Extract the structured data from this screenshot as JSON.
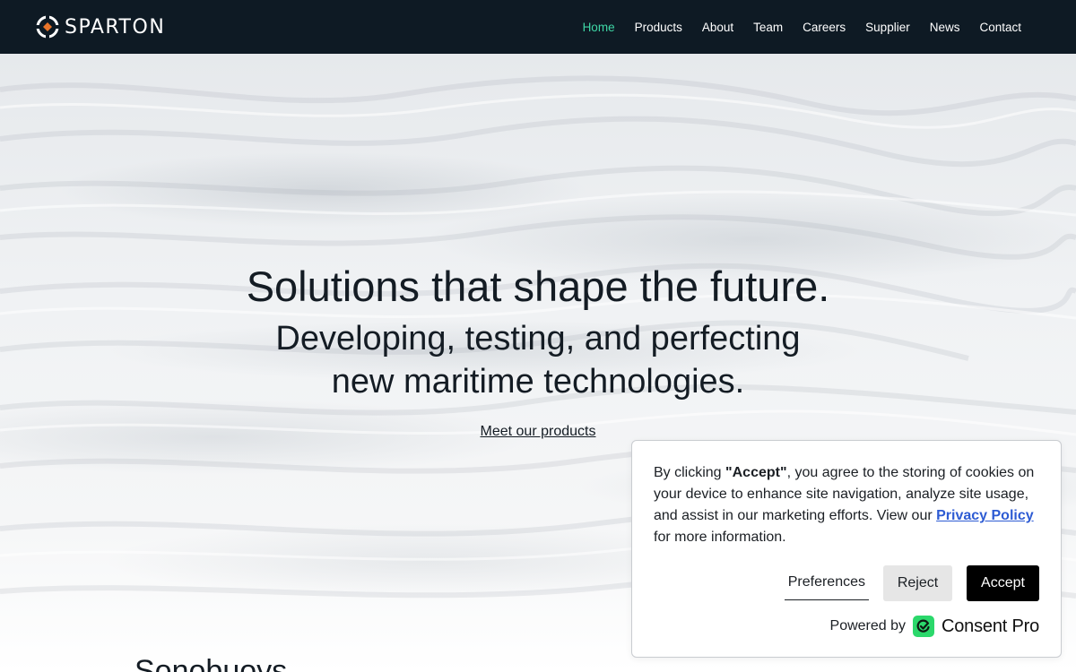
{
  "nav": {
    "brand": "SPARTON",
    "links": [
      {
        "label": "Home",
        "active": true
      },
      {
        "label": "Products",
        "active": false
      },
      {
        "label": "About",
        "active": false
      },
      {
        "label": "Team",
        "active": false
      },
      {
        "label": "Careers",
        "active": false
      },
      {
        "label": "Supplier",
        "active": false
      },
      {
        "label": "News",
        "active": false
      },
      {
        "label": "Contact",
        "active": false
      }
    ],
    "active_color": "#3ed6a5",
    "background": "#0e1a24"
  },
  "hero": {
    "title": "Solutions that shape the future.",
    "subtitle_line1": "Developing, testing, and perfecting",
    "subtitle_line2": "new maritime technologies.",
    "cta_link": "Meet our products"
  },
  "section": {
    "heading": "Sonobuoys"
  },
  "cookie_banner": {
    "text_prefix": "By clicking ",
    "accept_quote": "\"Accept\"",
    "text_middle": ", you agree to the storing of cookies on your device to enhance site navigation, analyze site usage, and assist in our marketing efforts. View our ",
    "privacy_link": "Privacy Policy",
    "text_suffix": " for more information.",
    "preferences_label": "Preferences",
    "reject_label": "Reject",
    "accept_label": "Accept",
    "powered_by_label": "Powered by",
    "provider_name": "Consent Pro",
    "provider_icon": "checkmark-icon",
    "provider_color": "#2bd86b",
    "link_color": "#2d5bd3"
  }
}
